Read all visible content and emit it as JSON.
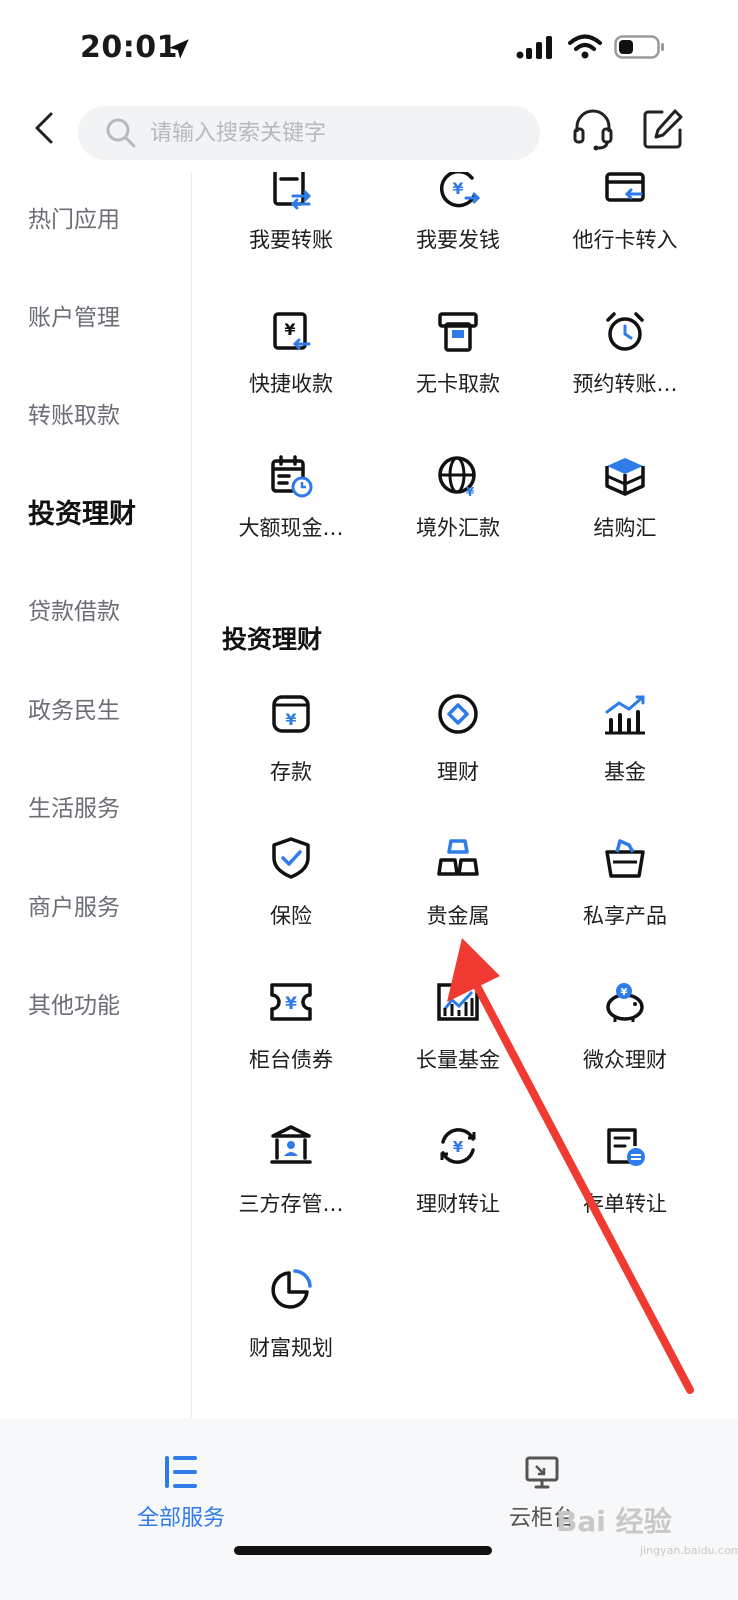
{
  "status": {
    "time": "20:01"
  },
  "search": {
    "placeholder": "请输入搜索关键字"
  },
  "sidebar": {
    "items": [
      {
        "label": "热门应用",
        "active": false
      },
      {
        "label": "账户管理",
        "active": false
      },
      {
        "label": "转账取款",
        "active": false
      },
      {
        "label": "投资理财",
        "active": true
      },
      {
        "label": "贷款借款",
        "active": false
      },
      {
        "label": "政务民生",
        "active": false
      },
      {
        "label": "生活服务",
        "active": false
      },
      {
        "label": "商户服务",
        "active": false
      },
      {
        "label": "其他功能",
        "active": false
      }
    ]
  },
  "transfer_section": {
    "items": [
      {
        "label": "我要转账",
        "icon": "transfer-document-icon"
      },
      {
        "label": "我要发钱",
        "icon": "send-money-icon"
      },
      {
        "label": "他行卡转入",
        "icon": "card-transfer-in-icon"
      },
      {
        "label": "快捷收款",
        "icon": "quick-receive-icon"
      },
      {
        "label": "无卡取款",
        "icon": "cardless-withdraw-icon"
      },
      {
        "label": "预约转账…",
        "icon": "alarm-clock-icon"
      },
      {
        "label": "大额现金…",
        "icon": "calendar-clock-icon"
      },
      {
        "label": "境外汇款",
        "icon": "globe-icon"
      },
      {
        "label": "结购汇",
        "icon": "cube-stack-icon"
      }
    ]
  },
  "invest_section": {
    "title": "投资理财",
    "items": [
      {
        "label": "存款",
        "icon": "deposit-box-icon"
      },
      {
        "label": "理财",
        "icon": "diamond-circle-icon"
      },
      {
        "label": "基金",
        "icon": "bar-chart-icon"
      },
      {
        "label": "保险",
        "icon": "shield-check-icon"
      },
      {
        "label": "贵金属",
        "icon": "gold-bars-icon"
      },
      {
        "label": "私享产品",
        "icon": "basket-icon"
      },
      {
        "label": "柜台债券",
        "icon": "bond-ticket-icon"
      },
      {
        "label": "长量基金",
        "icon": "chart-frame-icon"
      },
      {
        "label": "微众理财",
        "icon": "piggy-bank-icon"
      },
      {
        "label": "三方存管…",
        "icon": "bank-building-icon"
      },
      {
        "label": "理财转让",
        "icon": "exchange-cycle-icon"
      },
      {
        "label": "存单转让",
        "icon": "certificate-transfer-icon"
      },
      {
        "label": "财富规划",
        "icon": "pie-chart-icon"
      }
    ]
  },
  "bottom_tabs": [
    {
      "label": "全部服务",
      "active": true,
      "icon": "all-services-icon"
    },
    {
      "label": "云柜台",
      "active": false,
      "icon": "cloud-counter-icon"
    }
  ],
  "colors": {
    "accent": "#2f7be9",
    "text": "#1f1f1f",
    "muted": "#6b6e75",
    "annotation": "#f03a32"
  },
  "watermark": {
    "brand": "Bai 经验",
    "domain": "jingyan.baidu.com"
  }
}
